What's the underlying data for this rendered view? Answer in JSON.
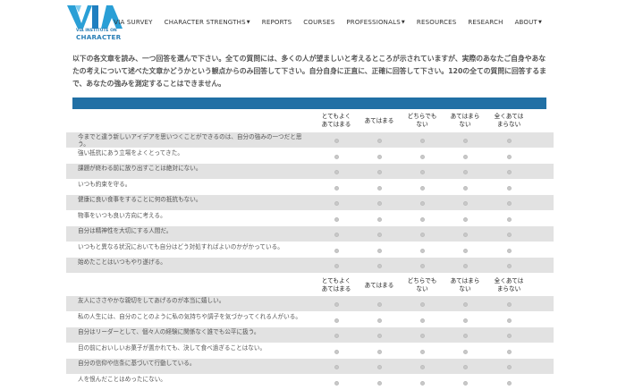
{
  "logo": {
    "initials": "VIA",
    "line1": "VIA INSTITUTE ON",
    "line2": "CHARACTER",
    "color": "#2a7fb6"
  },
  "nav": [
    {
      "label": "VIA SURVEY",
      "caret": false
    },
    {
      "label": "CHARACTER STRENGTHS",
      "caret": true
    },
    {
      "label": "REPORTS",
      "caret": false
    },
    {
      "label": "COURSES",
      "caret": false
    },
    {
      "label": "PROFESSIONALS",
      "caret": true
    },
    {
      "label": "RESOURCES",
      "caret": false
    },
    {
      "label": "RESEARCH",
      "caret": false
    },
    {
      "label": "ABOUT",
      "caret": true
    }
  ],
  "intro": "以下の各文章を読み、一つ回答を選んで下さい。全ての質問には、多くの人が望ましいと考えるところが示されていますが、実際のあなたご自身やあなたの考えについて述べた文章かどうかという観点からのみ回答して下さい。自分自身に正直に、正確に回答して下さい。120の全ての質問に回答するまで、あなたの強みを測定することはできません。",
  "band_color": "#2170a5",
  "columns": [
    {
      "line1": "とてもよく",
      "line2": "あてはまる"
    },
    {
      "line1": "あてはまる",
      "line2": ""
    },
    {
      "line1": "どちらでも",
      "line2": "ない"
    },
    {
      "line1": "あてはまら",
      "line2": "ない"
    },
    {
      "line1": "全くあては",
      "line2": "まらない"
    }
  ],
  "questions_block1": [
    "今までと違う新しいアイデアを思いつくことができるのは、自分の強みの一つだと思う。",
    "強い抵抗にあう立場をよくとってきた。",
    "課題が終わる前に放り出すことは絶対にない。",
    "いつも約束を守る。",
    "健康に良い食事をすることに何の抵抗もない。",
    "物事をいつも良い方向に考える。",
    "自分は精神性を大切にする人間だ。",
    "いつもと異なる状況においても自分はどう対処すればよいのかがかっている。",
    "始めたことはいつもやり遂げる。"
  ],
  "questions_block2": [
    "友人にささやかな親切をしてあげるのが本当に嬉しい。",
    "私の人生には、自分のことのように私の気持ちや調子を気づかってくれる人がいる。",
    "自分はリーダーとして、個々人の経験に関係なく誰でも公平に扱う。",
    "目の前においしいお菓子が置かれても、決して食べ過ぎることはない。",
    "自分の信仰や信条に基づいて行動している。",
    "人を恨んだことはめったにない。"
  ]
}
